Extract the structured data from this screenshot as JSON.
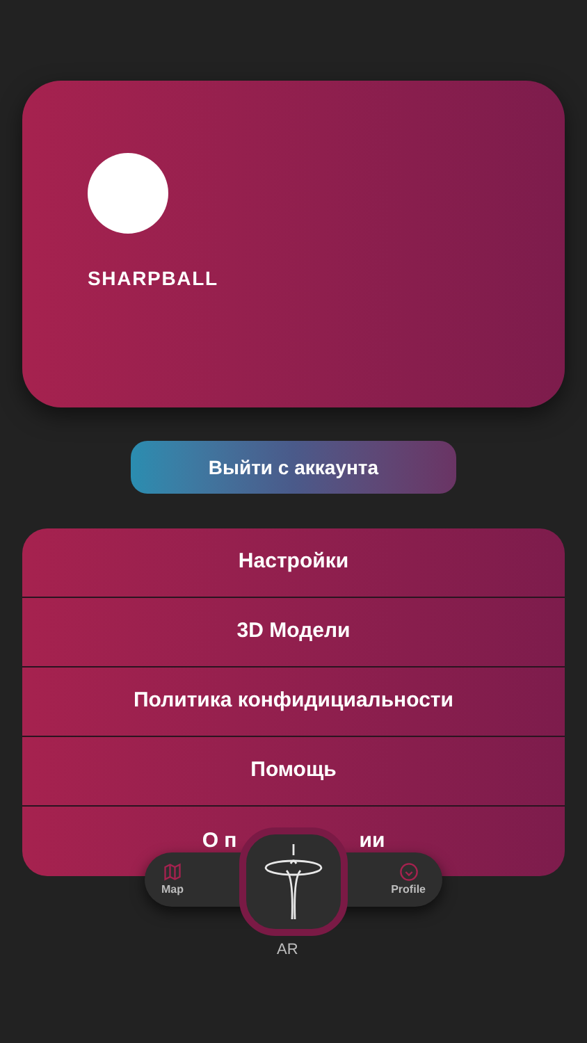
{
  "profile": {
    "name": "SHARPBALL"
  },
  "logout_button": "Выйти с аккаунта",
  "menu": [
    {
      "kind": "text",
      "label": "Настройки"
    },
    {
      "kind": "text",
      "label": "3D Модели"
    },
    {
      "kind": "text",
      "label": "Политика конфидициальности"
    },
    {
      "kind": "text",
      "label": "Помощь"
    },
    {
      "kind": "covered",
      "visible_parts": [
        "О п",
        "ии"
      ]
    }
  ],
  "tab_bar": {
    "left": {
      "label": "Map"
    },
    "center": {
      "label": "AR"
    },
    "right": {
      "label": "Profile"
    }
  }
}
